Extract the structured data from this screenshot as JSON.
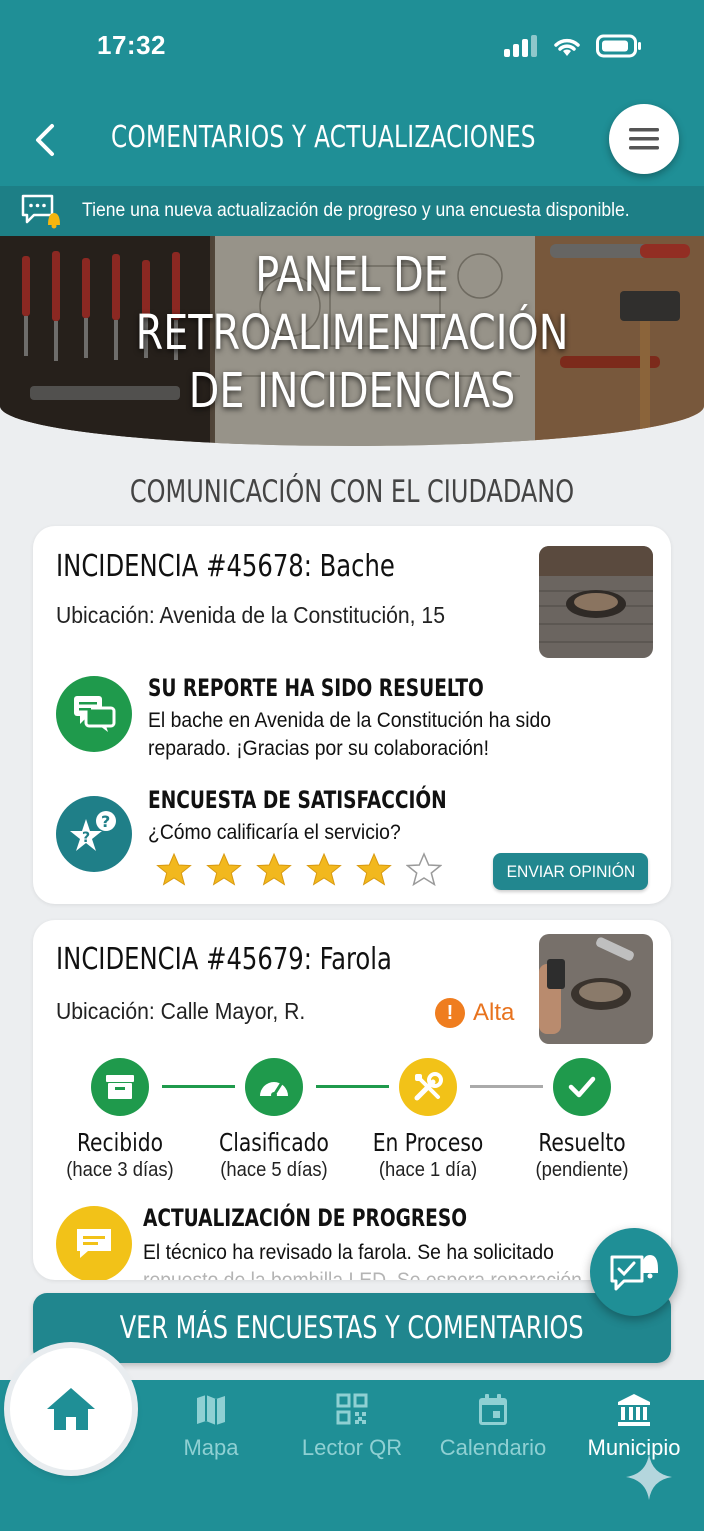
{
  "status_bar": {
    "time": "17:32"
  },
  "header": {
    "title": "COMENTARIOS Y ACTUALIZACIONES"
  },
  "notification": {
    "text": "Tiene una nueva actualización de progreso y una encuesta disponible."
  },
  "hero": {
    "title_line1": "PANEL DE",
    "title_line2": "RETROALIMENTACIÓN",
    "title_line3": "DE INCIDENCIAS"
  },
  "section_title": "COMUNICACIÓN CON EL CIUDADANO",
  "incidents": [
    {
      "title": "INCIDENCIA #45678: Bache",
      "location": "Ubicación: Avenida de la Constitución, 15",
      "resolved_heading": "SU REPORTE HA SIDO RESUELTO",
      "resolved_line1": "El bache en Avenida de la Constitución ha sido",
      "resolved_line2": "reparado. ¡Gracias por su colaboración!",
      "survey_heading": "ENCUESTA DE SATISFACCIÓN",
      "survey_question": "¿Cómo calificaría el servicio?",
      "rating": 5,
      "rating_max": 6,
      "send_label": "ENVIAR OPINIÓN"
    },
    {
      "title": "INCIDENCIA #45679: Farola",
      "location": "Ubicación: Calle Mayor, R.",
      "priority": "Alta",
      "steps": [
        {
          "label": "Recibido",
          "sub": "(hace 3 días)",
          "color": "#1f9a4c"
        },
        {
          "label": "Clasificado",
          "sub": "(hace 5 días)",
          "color": "#1f9a4c"
        },
        {
          "label": "En Proceso",
          "sub": "(hace 1 día)",
          "color": "#f2c218"
        },
        {
          "label": "Resuelto",
          "sub": "(pendiente)",
          "color": "#1f9a4c"
        }
      ],
      "progress_heading": "ACTUALIZACIÓN DE PROGRESO",
      "progress_line1": "El técnico ha revisado la farola. Se ha solicitado",
      "progress_line2": "repuesto de la bombilla LED. Se espera reparación"
    }
  ],
  "more_button": "VER MÁS ENCUESTAS Y COMENTARIOS",
  "nav": [
    {
      "label": "Mapa",
      "icon": "map-icon"
    },
    {
      "label": "Lector QR",
      "icon": "qr-icon"
    },
    {
      "label": "Calendario",
      "icon": "calendar-icon"
    },
    {
      "label": "Municipio",
      "icon": "municipality-icon"
    }
  ],
  "colors": {
    "teal": "#1f8f96",
    "green": "#1f9a4c",
    "yellow": "#f2c218",
    "orange": "#ef7d1f",
    "star": "#f2b81e"
  }
}
